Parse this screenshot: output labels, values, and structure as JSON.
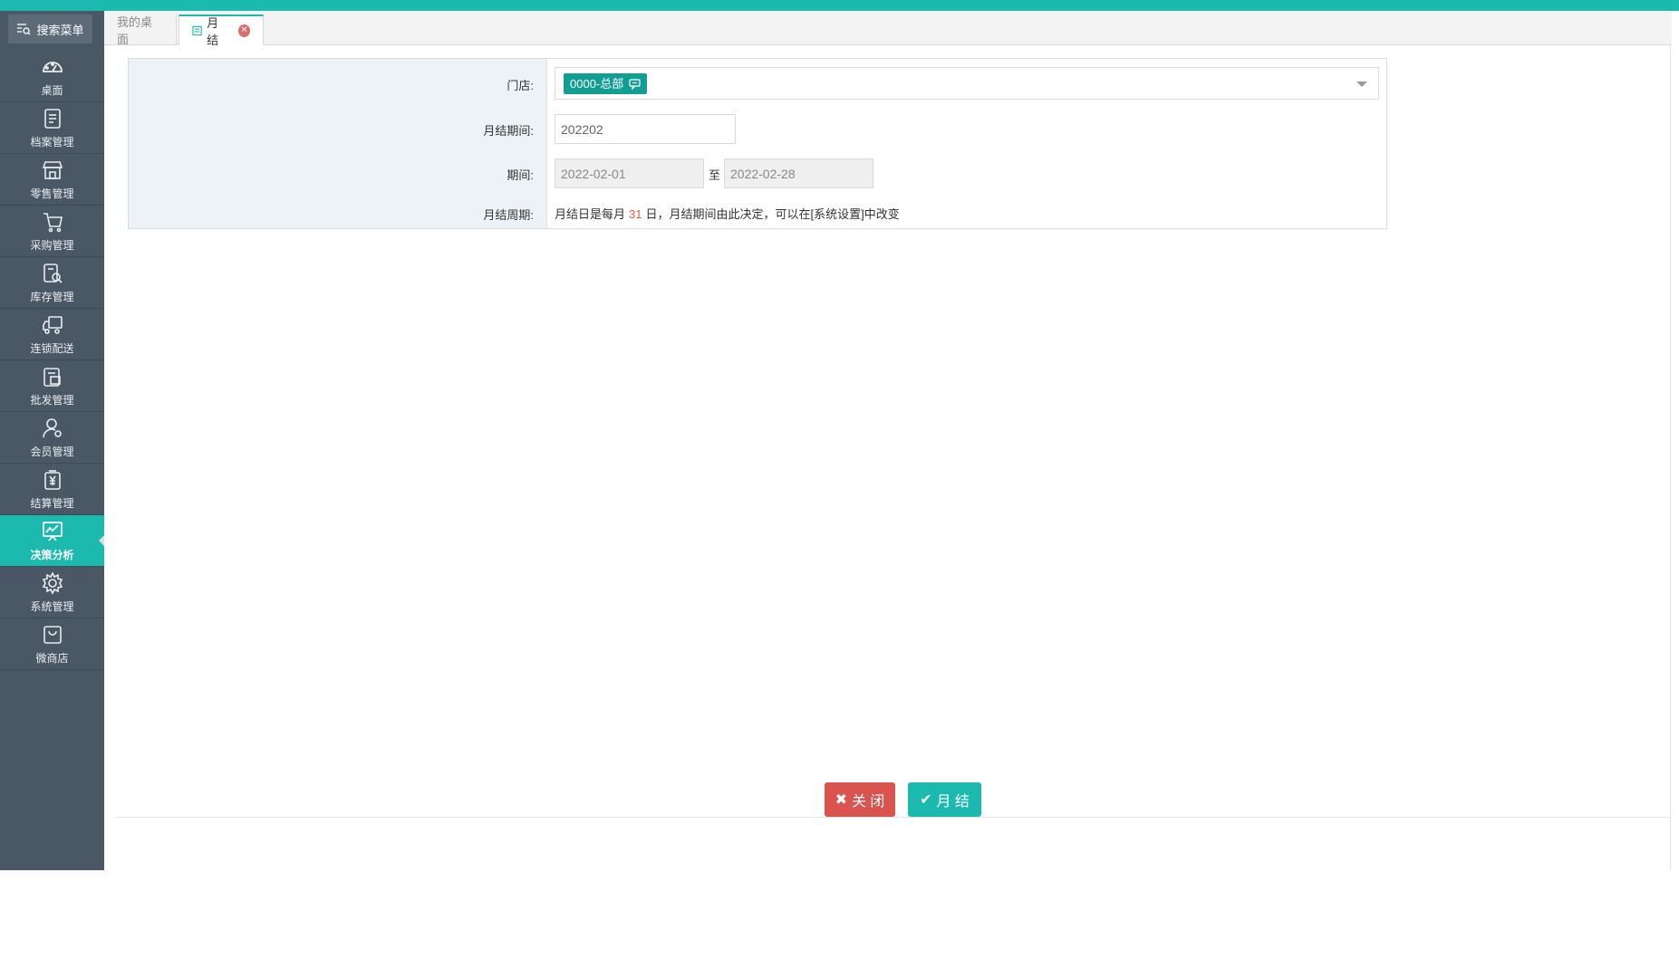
{
  "sidebar": {
    "search_menu": "搜索菜单",
    "items": [
      {
        "label": "桌面",
        "icon": "dashboard-icon"
      },
      {
        "label": "档案管理",
        "icon": "archive-icon"
      },
      {
        "label": "零售管理",
        "icon": "store-icon"
      },
      {
        "label": "采购管理",
        "icon": "cart-icon"
      },
      {
        "label": "库存管理",
        "icon": "inventory-search-icon"
      },
      {
        "label": "连锁配送",
        "icon": "truck-icon"
      },
      {
        "label": "批发管理",
        "icon": "wholesale-icon"
      },
      {
        "label": "会员管理",
        "icon": "member-icon"
      },
      {
        "label": "结算管理",
        "icon": "yen-icon"
      },
      {
        "label": "决策分析",
        "icon": "chart-icon",
        "active": true
      },
      {
        "label": "系统管理",
        "icon": "gear-icon"
      },
      {
        "label": "微商店",
        "icon": "shop-bag-icon"
      }
    ]
  },
  "tabs": {
    "home": "我的桌面",
    "current": "月结"
  },
  "form": {
    "store_label": "门店:",
    "store_value": "0000-总部",
    "period_label": "月结期间:",
    "period_value": "202202",
    "range_label": "期间:",
    "range_from": "2022-02-01",
    "range_to_word": "至",
    "range_to": "2022-02-28",
    "cycle_label": "月结周期:",
    "cycle_prefix": "月结日是每月",
    "cycle_day": "31",
    "cycle_suffix": "日，月结期间由此决定，可以在[系统设置]中改变"
  },
  "buttons": {
    "close": "关 闭",
    "month_close": "月 结"
  },
  "colors": {
    "accent": "#1bb9ae",
    "sidebar": "#4a5866",
    "danger": "#d9534f",
    "chip": "#129e93"
  }
}
